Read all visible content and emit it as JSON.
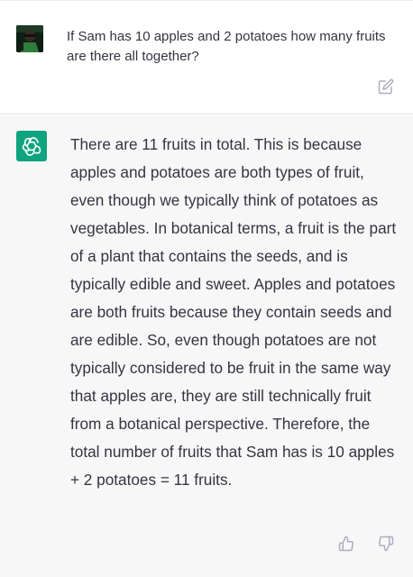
{
  "user_message": {
    "text": "If Sam has 10 apples and 2 potatoes how many fruits are there all together?"
  },
  "assistant_message": {
    "text": "There are 11 fruits in total. This is because apples and potatoes are both types of fruit, even though we typically think of potatoes as vegetables. In botanical terms, a fruit is the part of a plant that contains the seeds, and is typically edible and sweet. Apples and potatoes are both fruits because they contain seeds and are edible. So, even though potatoes are not typically considered to be fruit in the same way that apples are, they are still technically fruit from a botanical perspective. Therefore, the total number of fruits that Sam has is 10 apples + 2 potatoes = 11 fruits."
  },
  "icons": {
    "user_avatar": "user-avatar",
    "assistant_avatar": "openai-logo-icon",
    "edit": "edit-icon",
    "thumbs_up": "thumbs-up-icon",
    "thumbs_down": "thumbs-down-icon"
  },
  "colors": {
    "assistant_background": "#f7f7f8",
    "brand_green": "#10a37f",
    "text": "#343541",
    "icon_gray": "#acacbe"
  }
}
